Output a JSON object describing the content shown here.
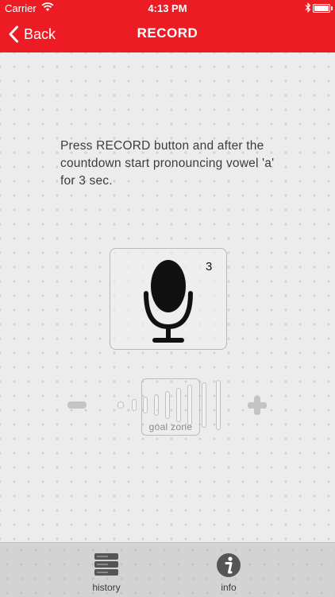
{
  "status_bar": {
    "carrier": "Carrier",
    "time": "4:13 PM"
  },
  "nav": {
    "back_label": "Back",
    "title": "RECORD"
  },
  "colors": {
    "brand_red": "#ed1c24",
    "background": "#ececec"
  },
  "main": {
    "instruction": "Press RECORD button and after the countdown start pronouncing vowel 'a' for 3 sec.",
    "countdown": "3",
    "record_icon": "microphone-icon",
    "goal_zone_label": "goal zone"
  },
  "tabs": [
    {
      "label": "history",
      "icon": "server-stack-icon"
    },
    {
      "label": "info",
      "icon": "info-icon"
    }
  ]
}
